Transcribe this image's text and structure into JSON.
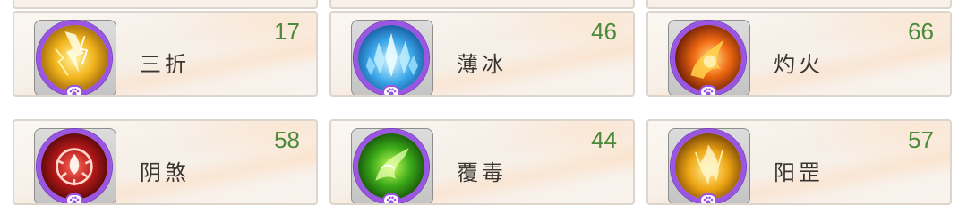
{
  "items": [
    {
      "name": "三折",
      "count": "17",
      "icon": "lightning-icon",
      "theme": "yellow"
    },
    {
      "name": "薄冰",
      "count": "46",
      "icon": "ice-crystal-icon",
      "theme": "blue"
    },
    {
      "name": "灼火",
      "count": "66",
      "icon": "fire-swirl-icon",
      "theme": "red"
    },
    {
      "name": "阴煞",
      "count": "58",
      "icon": "crimson-sigil-icon",
      "theme": "crimson"
    },
    {
      "name": "覆毒",
      "count": "44",
      "icon": "poison-swirl-icon",
      "theme": "green"
    },
    {
      "name": "阳罡",
      "count": "57",
      "icon": "golden-flame-icon",
      "theme": "gold"
    }
  ],
  "colors": {
    "count_text": "#4a8a3a",
    "ring": "#9a55e3",
    "card_border": "#ddd5cc"
  }
}
